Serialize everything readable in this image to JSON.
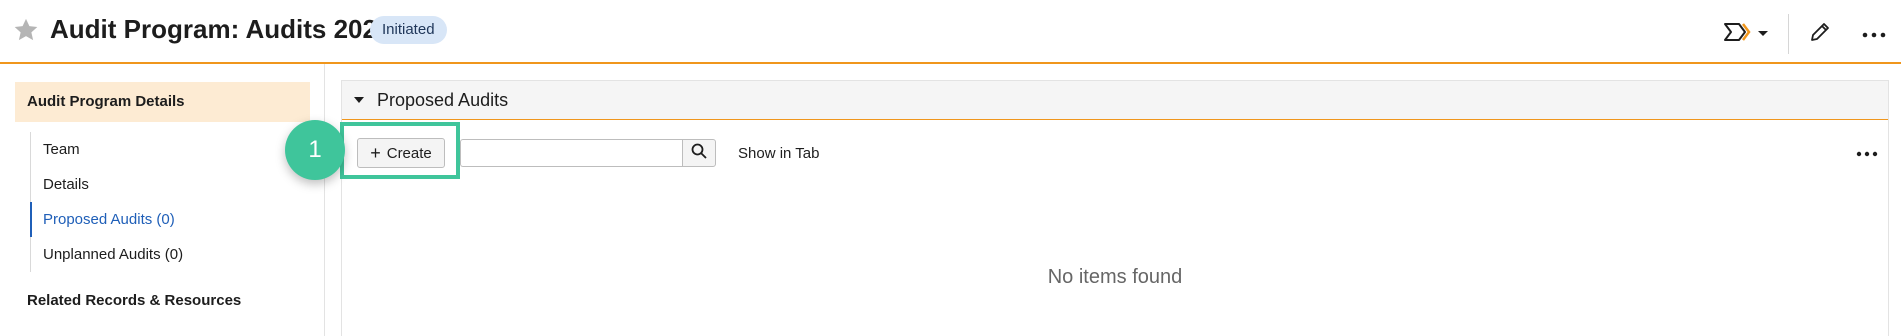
{
  "header": {
    "title": "Audit Program: Audits 2025",
    "status": "Initiated",
    "icons": {
      "favorite": "star-icon",
      "workflow": "workflow-chevron-icon",
      "edit": "pencil-icon",
      "more": "more-horizontal-icon"
    }
  },
  "sidebar": {
    "section_title": "Audit Program Details",
    "items": [
      {
        "label": "Team",
        "active": false
      },
      {
        "label": "Details",
        "active": false
      },
      {
        "label": "Proposed Audits (0)",
        "active": true
      },
      {
        "label": "Unplanned Audits (0)",
        "active": false
      }
    ],
    "section2_title": "Related Records & Resources"
  },
  "panel": {
    "title": "Proposed Audits",
    "create_label": "Create",
    "search_value": "",
    "show_in_tab_label": "Show in Tab",
    "empty_text": "No items found"
  },
  "callout": {
    "step": "1"
  },
  "colors": {
    "accent": "#f0961c",
    "active_link": "#1f5fb8",
    "status_bg": "#d8e6f7",
    "callout": "#3fc59b",
    "section_highlight": "#fdebd3"
  }
}
